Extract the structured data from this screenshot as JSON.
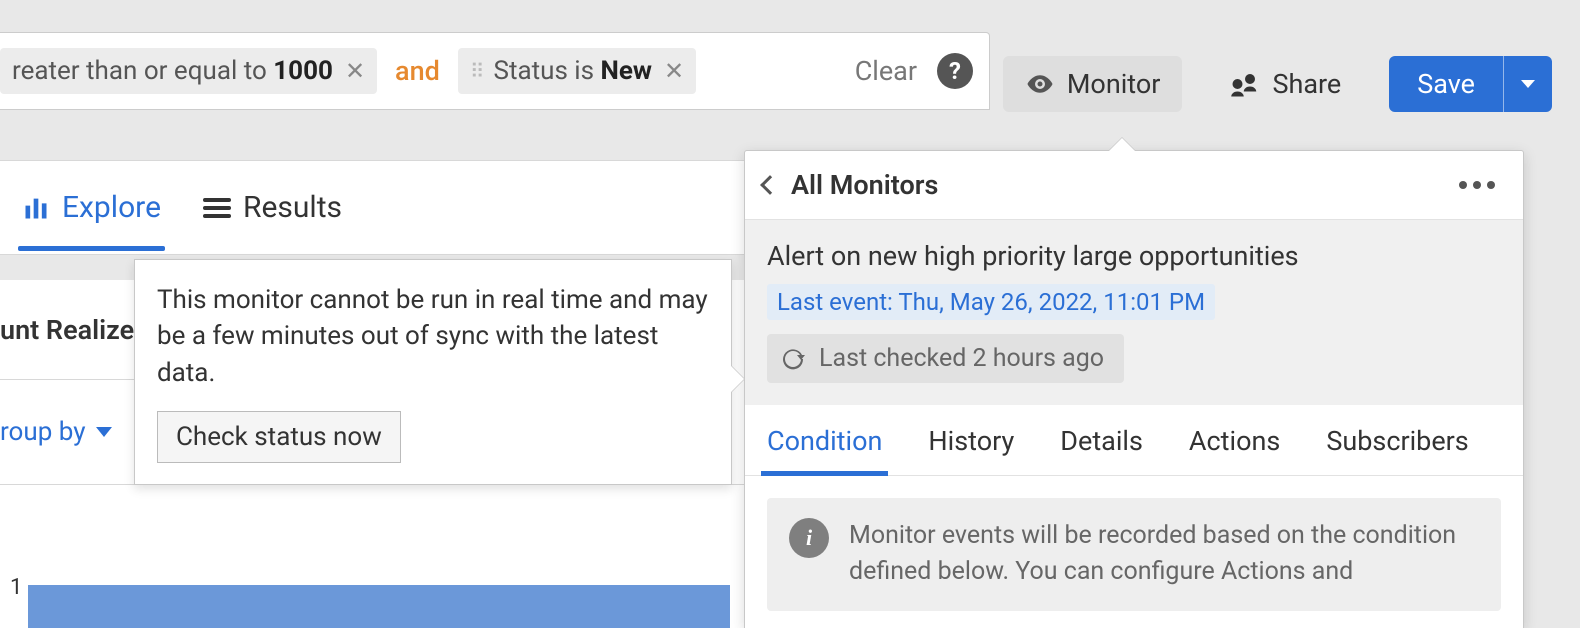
{
  "filters": {
    "pill1_prefix": "reater than or equal to ",
    "pill1_strong": "1000",
    "separator": "and",
    "pill2_prefix": "Status is ",
    "pill2_strong": "New",
    "clear": "Clear"
  },
  "actions": {
    "monitor": "Monitor",
    "share": "Share",
    "save": "Save"
  },
  "tabs": {
    "explore": "Explore",
    "results": "Results"
  },
  "grid": {
    "yaxis_label": "unt Realized",
    "group_by": "roup by",
    "axis_tick1": "1"
  },
  "tooltip": {
    "text": "This monitor cannot be run in real time and may be a few minutes out of sync with the latest data.",
    "button": "Check status now"
  },
  "monitor_panel": {
    "back_label": "All Monitors",
    "alert_title": "Alert on new high priority large opportunities",
    "last_event": "Last event: Thu, May 26, 2022, 11:01 PM",
    "last_checked": "Last checked 2 hours ago",
    "tabs": [
      "Condition",
      "History",
      "Details",
      "Actions",
      "Subscribers"
    ],
    "active_tab": 0,
    "condition_info": "Monitor events will be recorded based on the condition defined below. You can configure Actions and"
  }
}
